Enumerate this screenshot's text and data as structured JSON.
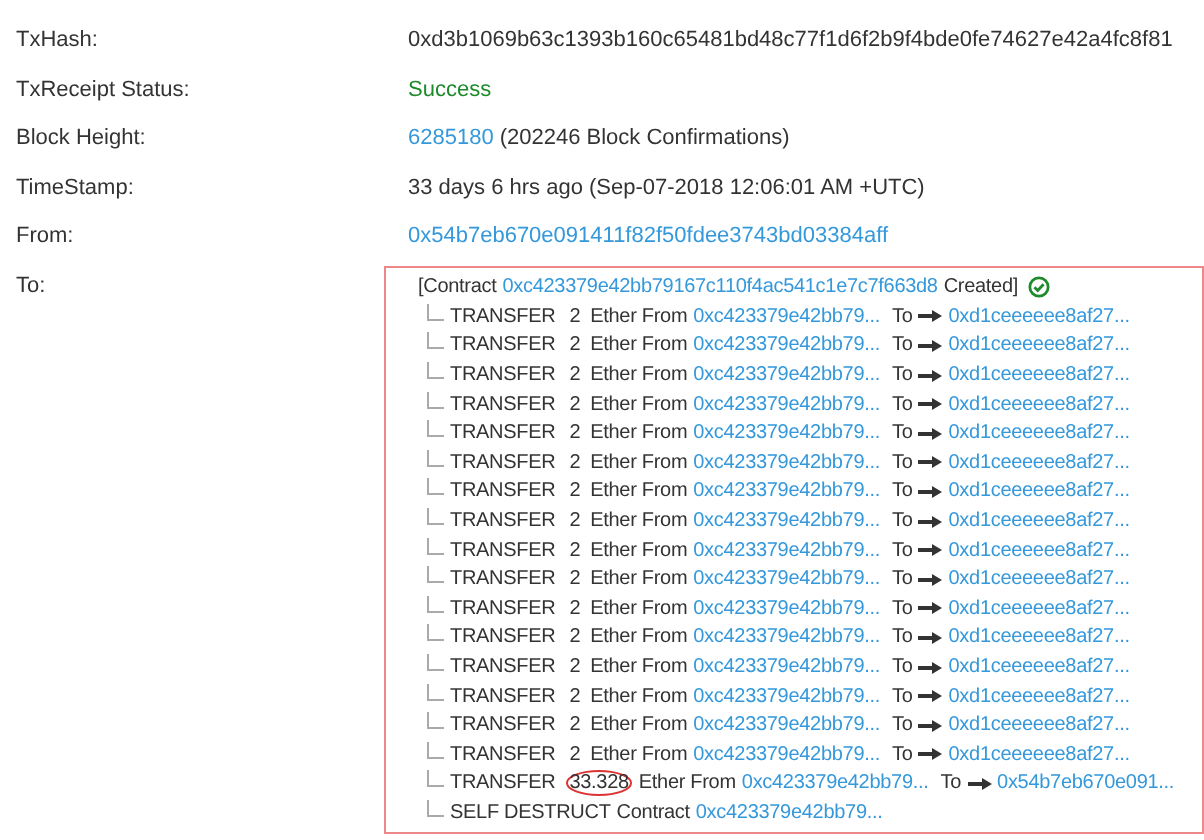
{
  "fields": [
    {
      "label": "TxHash:",
      "kind": "text",
      "parts": [
        {
          "text": "0xd3b1069b63c1393b160c65481bd48c77f1d6f2b9f4bde0fe74627e42a4fc8f81",
          "kind": "plain"
        }
      ]
    },
    {
      "label": "TxReceipt Status:",
      "kind": "text",
      "parts": [
        {
          "text": "Success",
          "kind": "success"
        }
      ]
    },
    {
      "label": "Block Height:",
      "kind": "text",
      "parts": [
        {
          "text": "6285180",
          "kind": "link"
        },
        {
          "text": "(202246 Block Confirmations)",
          "kind": "plain"
        }
      ]
    },
    {
      "label": "TimeStamp:",
      "kind": "text",
      "parts": [
        {
          "text": "33 days 6 hrs ago (Sep-07-2018 12:06:01 AM +UTC)",
          "kind": "plain"
        }
      ]
    },
    {
      "label": "From:",
      "kind": "text",
      "parts": [
        {
          "text": "0x54b7eb670e091411f82f50fdee3743bd03384aff",
          "kind": "link"
        }
      ]
    }
  ],
  "to": {
    "label": "To:",
    "highlighted": true,
    "contract": {
      "prefix": "[Contract",
      "address": "0xc423379e42bb79167c110f4ac541c1e7c7f663d8",
      "suffix": "Created]",
      "verified": true
    },
    "calls": [
      {
        "kind": "transfer",
        "type": "TRANSFER",
        "amount": "2",
        "circled": false,
        "from_label": "Ether From",
        "from": "0xc423379e42bb79...",
        "to_label": "To",
        "to": "0xd1ceeeeee8af27..."
      },
      {
        "kind": "transfer",
        "type": "TRANSFER",
        "amount": "2",
        "circled": false,
        "from_label": "Ether From",
        "from": "0xc423379e42bb79...",
        "to_label": "To",
        "to": "0xd1ceeeeee8af27..."
      },
      {
        "kind": "transfer",
        "type": "TRANSFER",
        "amount": "2",
        "circled": false,
        "from_label": "Ether From",
        "from": "0xc423379e42bb79...",
        "to_label": "To",
        "to": "0xd1ceeeeee8af27..."
      },
      {
        "kind": "transfer",
        "type": "TRANSFER",
        "amount": "2",
        "circled": false,
        "from_label": "Ether From",
        "from": "0xc423379e42bb79...",
        "to_label": "To",
        "to": "0xd1ceeeeee8af27..."
      },
      {
        "kind": "transfer",
        "type": "TRANSFER",
        "amount": "2",
        "circled": false,
        "from_label": "Ether From",
        "from": "0xc423379e42bb79...",
        "to_label": "To",
        "to": "0xd1ceeeeee8af27..."
      },
      {
        "kind": "transfer",
        "type": "TRANSFER",
        "amount": "2",
        "circled": false,
        "from_label": "Ether From",
        "from": "0xc423379e42bb79...",
        "to_label": "To",
        "to": "0xd1ceeeeee8af27..."
      },
      {
        "kind": "transfer",
        "type": "TRANSFER",
        "amount": "2",
        "circled": false,
        "from_label": "Ether From",
        "from": "0xc423379e42bb79...",
        "to_label": "To",
        "to": "0xd1ceeeeee8af27..."
      },
      {
        "kind": "transfer",
        "type": "TRANSFER",
        "amount": "2",
        "circled": false,
        "from_label": "Ether From",
        "from": "0xc423379e42bb79...",
        "to_label": "To",
        "to": "0xd1ceeeeee8af27..."
      },
      {
        "kind": "transfer",
        "type": "TRANSFER",
        "amount": "2",
        "circled": false,
        "from_label": "Ether From",
        "from": "0xc423379e42bb79...",
        "to_label": "To",
        "to": "0xd1ceeeeee8af27..."
      },
      {
        "kind": "transfer",
        "type": "TRANSFER",
        "amount": "2",
        "circled": false,
        "from_label": "Ether From",
        "from": "0xc423379e42bb79...",
        "to_label": "To",
        "to": "0xd1ceeeeee8af27..."
      },
      {
        "kind": "transfer",
        "type": "TRANSFER",
        "amount": "2",
        "circled": false,
        "from_label": "Ether From",
        "from": "0xc423379e42bb79...",
        "to_label": "To",
        "to": "0xd1ceeeeee8af27..."
      },
      {
        "kind": "transfer",
        "type": "TRANSFER",
        "amount": "2",
        "circled": false,
        "from_label": "Ether From",
        "from": "0xc423379e42bb79...",
        "to_label": "To",
        "to": "0xd1ceeeeee8af27..."
      },
      {
        "kind": "transfer",
        "type": "TRANSFER",
        "amount": "2",
        "circled": false,
        "from_label": "Ether From",
        "from": "0xc423379e42bb79...",
        "to_label": "To",
        "to": "0xd1ceeeeee8af27..."
      },
      {
        "kind": "transfer",
        "type": "TRANSFER",
        "amount": "2",
        "circled": false,
        "from_label": "Ether From",
        "from": "0xc423379e42bb79...",
        "to_label": "To",
        "to": "0xd1ceeeeee8af27..."
      },
      {
        "kind": "transfer",
        "type": "TRANSFER",
        "amount": "2",
        "circled": false,
        "from_label": "Ether From",
        "from": "0xc423379e42bb79...",
        "to_label": "To",
        "to": "0xd1ceeeeee8af27..."
      },
      {
        "kind": "transfer",
        "type": "TRANSFER",
        "amount": "2",
        "circled": false,
        "from_label": "Ether From",
        "from": "0xc423379e42bb79...",
        "to_label": "To",
        "to": "0xd1ceeeeee8af27..."
      },
      {
        "kind": "transfer",
        "type": "TRANSFER",
        "amount": "33.328",
        "circled": true,
        "from_label": "Ether From",
        "from": "0xc423379e42bb79...",
        "to_label": "To",
        "to": "0x54b7eb670e091..."
      },
      {
        "kind": "destruct",
        "type": "SELF DESTRUCT",
        "contract_label": "Contract",
        "contract": "0xc423379e42bb79..."
      }
    ]
  }
}
